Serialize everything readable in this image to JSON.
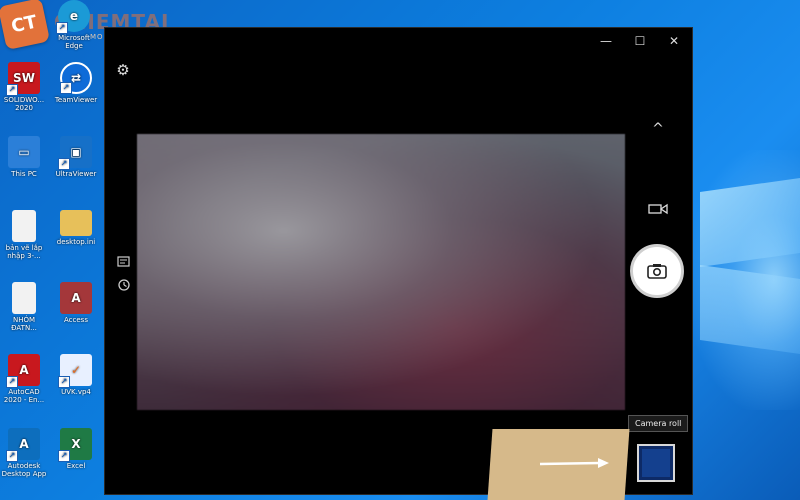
{
  "watermark": {
    "logo_text": "CT",
    "brand": "CHIEMTAI",
    "brand_sub": "MOBILE"
  },
  "desktop": {
    "icons": [
      {
        "name": "microsoft-edge-icon",
        "label": "Microsoft Edge",
        "color": "#1b9ad6",
        "glyph": "e"
      },
      {
        "name": "solidworks-icon",
        "label": "SOLIDWO... 2020",
        "color": "#c8181e",
        "glyph": "SW"
      },
      {
        "name": "teamviewer-icon",
        "label": "TeamViewer",
        "color": "#0e6bd8",
        "glyph": "⇄"
      },
      {
        "name": "this-pc-icon",
        "label": "This PC",
        "color": "#2b7fd8",
        "glyph": "▭"
      },
      {
        "name": "ultraviewer-icon",
        "label": "UltraViewer",
        "color": "#1670c8",
        "glyph": "▣"
      },
      {
        "name": "document-icon",
        "label": "bản vẽ lắp nhập 3-...",
        "color": "#f2f2f2",
        "glyph": ""
      },
      {
        "name": "folder-icon",
        "label": "desktop.ini",
        "color": "#e7c05a",
        "glyph": ""
      },
      {
        "name": "nhom-document-icon",
        "label": "NHÓM ĐATN...",
        "color": "#f2f2f2",
        "glyph": ""
      },
      {
        "name": "access-icon",
        "label": "Access",
        "color": "#a4373a",
        "glyph": "A"
      },
      {
        "name": "autocad-icon",
        "label": "AutoCAD 2020 - En...",
        "color": "#c8181e",
        "glyph": "A"
      },
      {
        "name": "uvkvp4-icon",
        "label": "UVK.vp4",
        "color": "#e8f0ff",
        "glyph": "✓"
      },
      {
        "name": "autodesk-desktop-app-icon",
        "label": "Autodesk Desktop App",
        "color": "#0d6ebd",
        "glyph": "A"
      },
      {
        "name": "excel-icon",
        "label": "Excel",
        "color": "#1f7a45",
        "glyph": "X"
      }
    ]
  },
  "camera": {
    "title_buttons": {
      "minimize": "—",
      "maximize": "☐",
      "close": "✕"
    },
    "settings_icon": "⚙",
    "chevron": "^",
    "video_icon": "▭",
    "shutter_icon": "◉",
    "tooltip": "Camera roll"
  }
}
